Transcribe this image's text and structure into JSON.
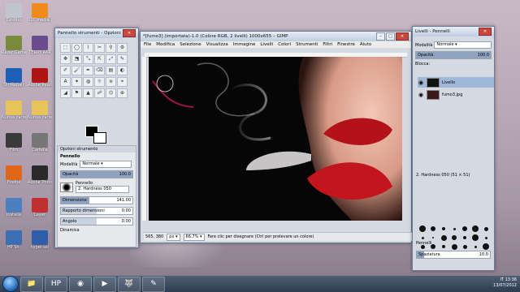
{
  "desktop": {
    "icons": [
      {
        "label": "Cestino",
        "color": "#bfc6cf"
      },
      {
        "label": "VLC media player",
        "color": "#f08a1c"
      },
      {
        "label": "Razer Game Booster",
        "color": "#7a8a3a"
      },
      {
        "label": "TERRY RAR",
        "color": "#6b4d8f"
      },
      {
        "label": "DirtRepair",
        "color": "#1b5fb8"
      },
      {
        "label": "Adobe Reader",
        "color": "#b01515"
      },
      {
        "label": "Nuova cartella",
        "color": "#e7c35a"
      },
      {
        "label": "Nuova cartella (2)",
        "color": "#e7c35a"
      },
      {
        "label": "Film",
        "color": "#3a3a3a"
      },
      {
        "label": "Cartella",
        "color": "#777777"
      },
      {
        "label": "Firefox",
        "color": "#e0671a"
      },
      {
        "label": "Adobe Photoshop",
        "color": "#2a2a2a"
      },
      {
        "label": "Installa",
        "color": "#4a7fc0"
      },
      {
        "label": "Layer",
        "color": "#c03030"
      },
      {
        "label": "HP Sh.",
        "color": "#3b6fb1"
      },
      {
        "label": "hyper.scr",
        "color": "#2f5fa8"
      }
    ]
  },
  "toolbox": {
    "title": "Pannello strumenti - Opzioni stru...",
    "tools": [
      "⬚",
      "◯",
      "⌇",
      "✂",
      "⚲",
      "⚙",
      "✥",
      "⬔",
      "⤡",
      "⇱",
      "⤢",
      "✎",
      "✐",
      "🖌",
      "✒",
      "⌫",
      "▤",
      "◐",
      "A",
      "✦",
      "◍",
      "☼",
      "≋",
      "⌖",
      "◢",
      "⚑",
      "▲",
      "☍",
      "⌬",
      "⊕"
    ],
    "tab_label": "Opzioni strumento",
    "section_title": "Pennello",
    "mode_label": "Modalità",
    "mode_value": "Normale",
    "opacity_label": "Opacità",
    "opacity_value": "100.0",
    "brush_label": "Pennello",
    "brush_name": "2. Hardness 050",
    "size_label": "Dimensione",
    "size_value": "141.00",
    "ratio_label": "Rapporto dimensioni",
    "ratio_value": "0.00",
    "angle_label": "Angolo",
    "angle_value": "0.00",
    "dynamics_label": "Dinamica"
  },
  "gimp": {
    "title": "*[fumo3] (importata)-1.0 (Colore RGB, 2 livelli) 1000x655 – GIMP",
    "menu": [
      "File",
      "Modifica",
      "Selezione",
      "Visualizza",
      "Immagine",
      "Livelli",
      "Colori",
      "Strumenti",
      "Filtri",
      "Finestre",
      "Aiuto"
    ],
    "coords": "565, 380",
    "unit": "px",
    "zoom": "66.7%",
    "status_text": "Fare clic per disegnare (Ctrl per prelevare un colore)"
  },
  "layers": {
    "title": "Livelli - Pennelli",
    "mode_label": "Modalità",
    "mode_value": "Normale",
    "opacity_label": "Opacità",
    "opacity_value": "100.0",
    "lock_label": "Blocca:",
    "items": [
      {
        "name": "Livello",
        "thumb": "#111111"
      },
      {
        "name": "fumo3.jpg",
        "thumb": "#3a1a1a"
      }
    ],
    "brush_current": "2. Hardness 050 (51 × 51)",
    "brushes_label": "Pennelli",
    "spacing_label": "Spaziatura",
    "spacing_value": "10.0"
  },
  "taskbar": {
    "apps": [
      "📁",
      "HP",
      "◉",
      "▶",
      "🐺",
      "✎"
    ],
    "language": "IT",
    "time": "13:36",
    "date": "13/07/2012"
  }
}
